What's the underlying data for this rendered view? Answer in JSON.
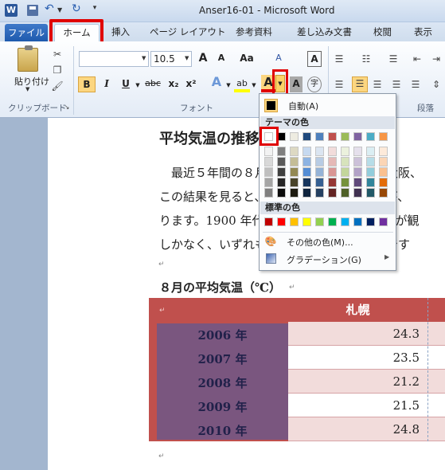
{
  "app": {
    "logo": "W",
    "title": "Anser16-01 - Microsoft Word"
  },
  "tabs": [
    "ファイル",
    "ホーム",
    "挿入",
    "ページ レイアウト",
    "参考資料",
    "差し込み文書",
    "校閲",
    "表示"
  ],
  "ribbon": {
    "paste_label": "貼り付け",
    "clipboard_label": "クリップボード",
    "font_label": "フォント",
    "paragraph_label": "段落",
    "font_size": "10.5",
    "bold": "B",
    "italic": "I",
    "underline": "U",
    "strike": "abc",
    "subscript": "x₂",
    "superscript": "x²",
    "grow": "A",
    "shrink": "A",
    "case": "Aa",
    "clear": "A",
    "text_effect": "A",
    "highlight": "ab",
    "font_color": "A",
    "char_shade": "A",
    "enclose": "字"
  },
  "document": {
    "heading": "平均気温の推移",
    "body_lines": [
      "最近５年間の８月の平均気温を、東京、大阪、",
      "この結果を見ると、いずれの都市も暑い年が、",
      "ります。1900 年代の東京の８月の平均気温が観",
      "しかなく、いずれも全国的に記録的な記録です"
    ],
    "table_title": "８月の平均気温（℃）",
    "table": {
      "header": [
        "",
        "札幌"
      ],
      "rows": [
        {
          "year": "2006 年",
          "value": "24.3"
        },
        {
          "year": "2007 年",
          "value": "23.5"
        },
        {
          "year": "2008 年",
          "value": "21.2"
        },
        {
          "year": "2009 年",
          "value": "21.5"
        },
        {
          "year": "2010 年",
          "value": "24.8"
        }
      ]
    }
  },
  "color_menu": {
    "auto_label": "自動(A)",
    "theme_header": "テーマの色",
    "standard_header": "標準の色",
    "more_colors": "その他の色(M)...",
    "gradient": "グラデーション(G)",
    "theme_top": [
      "#ffffff",
      "#000000",
      "#eeece1",
      "#1f497d",
      "#4f81bd",
      "#c0504d",
      "#9bbb59",
      "#8064a2",
      "#4bacc6",
      "#f79646"
    ],
    "theme_shades": [
      [
        "#f2f2f2",
        "#7f7f7f",
        "#ddd9c3",
        "#c6d9f0",
        "#dbe5f1",
        "#f2dcdb",
        "#ebf1dd",
        "#e5e0ec",
        "#dbeef3",
        "#fdeada"
      ],
      [
        "#d8d8d8",
        "#595959",
        "#c4bd97",
        "#8db3e2",
        "#b8cce4",
        "#e5b9b7",
        "#d7e3bc",
        "#ccc1d9",
        "#b7dde8",
        "#fbd5b5"
      ],
      [
        "#bfbfbf",
        "#3f3f3f",
        "#938953",
        "#548dd4",
        "#95b3d7",
        "#d99694",
        "#c3d69b",
        "#b2a2c7",
        "#92cddc",
        "#fac08f"
      ],
      [
        "#a5a5a5",
        "#262626",
        "#494429",
        "#17365d",
        "#366092",
        "#953734",
        "#76923c",
        "#5f497a",
        "#31859b",
        "#e36c09"
      ],
      [
        "#7f7f7f",
        "#0c0c0c",
        "#1d1b10",
        "#0f243e",
        "#244061",
        "#632423",
        "#4f6128",
        "#3f3151",
        "#205867",
        "#974806"
      ]
    ],
    "standard": [
      "#c00000",
      "#ff0000",
      "#ffc000",
      "#ffff00",
      "#92d050",
      "#00b050",
      "#00b0f0",
      "#0070c0",
      "#002060",
      "#7030a0"
    ]
  },
  "colors": {
    "table_header": "#c0504d",
    "table_year_cell": "#7a567f",
    "table_row_light": "#f2dcdb",
    "highlight_box": "#e00000"
  }
}
